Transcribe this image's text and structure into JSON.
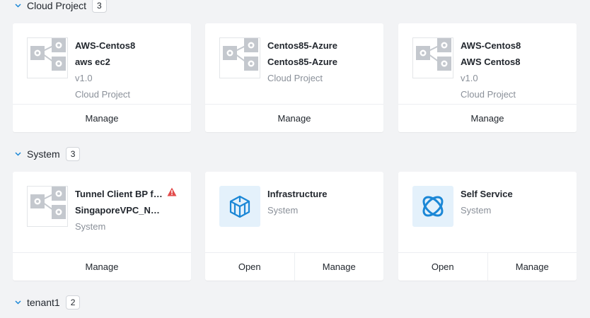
{
  "colors": {
    "page_bg": "#f2f3f5",
    "card_bg": "#ffffff",
    "title_text": "#22272e",
    "muted_text": "#8a9099",
    "accent_blue": "#1b87d6",
    "warning_red": "#e24b4b",
    "gear_gray": "#c4c8ce"
  },
  "sections": [
    {
      "title": "Cloud Project",
      "count": "3",
      "cards": [
        {
          "icon": "blueprint-gear-icon",
          "lines": [
            "AWS-Centos8",
            "aws ec2",
            "v1.0",
            "Cloud Project"
          ],
          "actions": [
            "Manage"
          ]
        },
        {
          "icon": "blueprint-gear-icon",
          "lines": [
            "Centos85-Azure",
            "Centos85-Azure",
            "Cloud Project"
          ],
          "actions": [
            "Manage"
          ]
        },
        {
          "icon": "blueprint-gear-icon",
          "lines": [
            "AWS-Centos8",
            "AWS Centos8",
            "v1.0",
            "Cloud Project"
          ],
          "actions": [
            "Manage"
          ]
        }
      ]
    },
    {
      "title": "System",
      "count": "3",
      "cards": [
        {
          "icon": "blueprint-gear-icon",
          "lines": [
            "Tunnel Client BP for SingaporeVPC",
            "SingaporeVPC_NTNX",
            "System"
          ],
          "warning": "warning-icon",
          "actions": [
            "Manage"
          ]
        },
        {
          "icon": "infrastructure-cube-icon",
          "lines": [
            "Infrastructure",
            "System"
          ],
          "actions": [
            "Open",
            "Manage"
          ]
        },
        {
          "icon": "self-service-orbit-icon",
          "lines": [
            "Self Service",
            "System"
          ],
          "actions": [
            "Open",
            "Manage"
          ]
        }
      ]
    },
    {
      "title": "tenant1",
      "count": "2",
      "cards": []
    }
  ]
}
